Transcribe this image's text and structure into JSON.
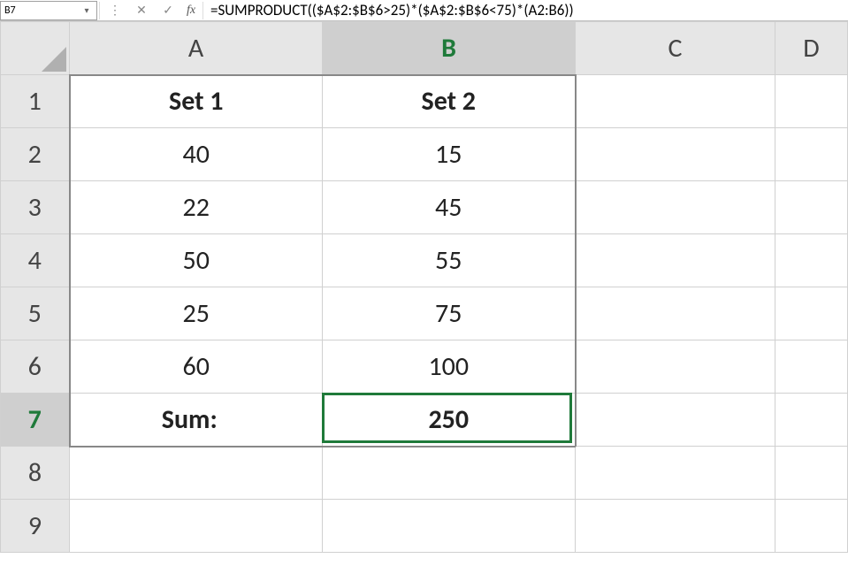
{
  "formula_bar": {
    "name_box": "B7",
    "fx_label": "fx",
    "cancel_glyph": "✕",
    "enter_glyph": "✓",
    "dots_glyph": "⋮",
    "formula": "=SUMPRODUCT(($A$2:$B$6>25)*($A$2:$B$6<75)*(A2:B6))"
  },
  "columns": [
    "A",
    "B",
    "C",
    "D"
  ],
  "rows": [
    "1",
    "2",
    "3",
    "4",
    "5",
    "6",
    "7",
    "8",
    "9"
  ],
  "active": {
    "col": "B",
    "row": "7"
  },
  "cells": {
    "A1": "Set 1",
    "B1": "Set 2",
    "A2": "40",
    "B2": "15",
    "A3": "22",
    "B3": "45",
    "A4": "50",
    "B4": "55",
    "A5": "25",
    "B5": "75",
    "A6": "60",
    "B6": "100",
    "A7": "Sum:",
    "B7": "250"
  }
}
